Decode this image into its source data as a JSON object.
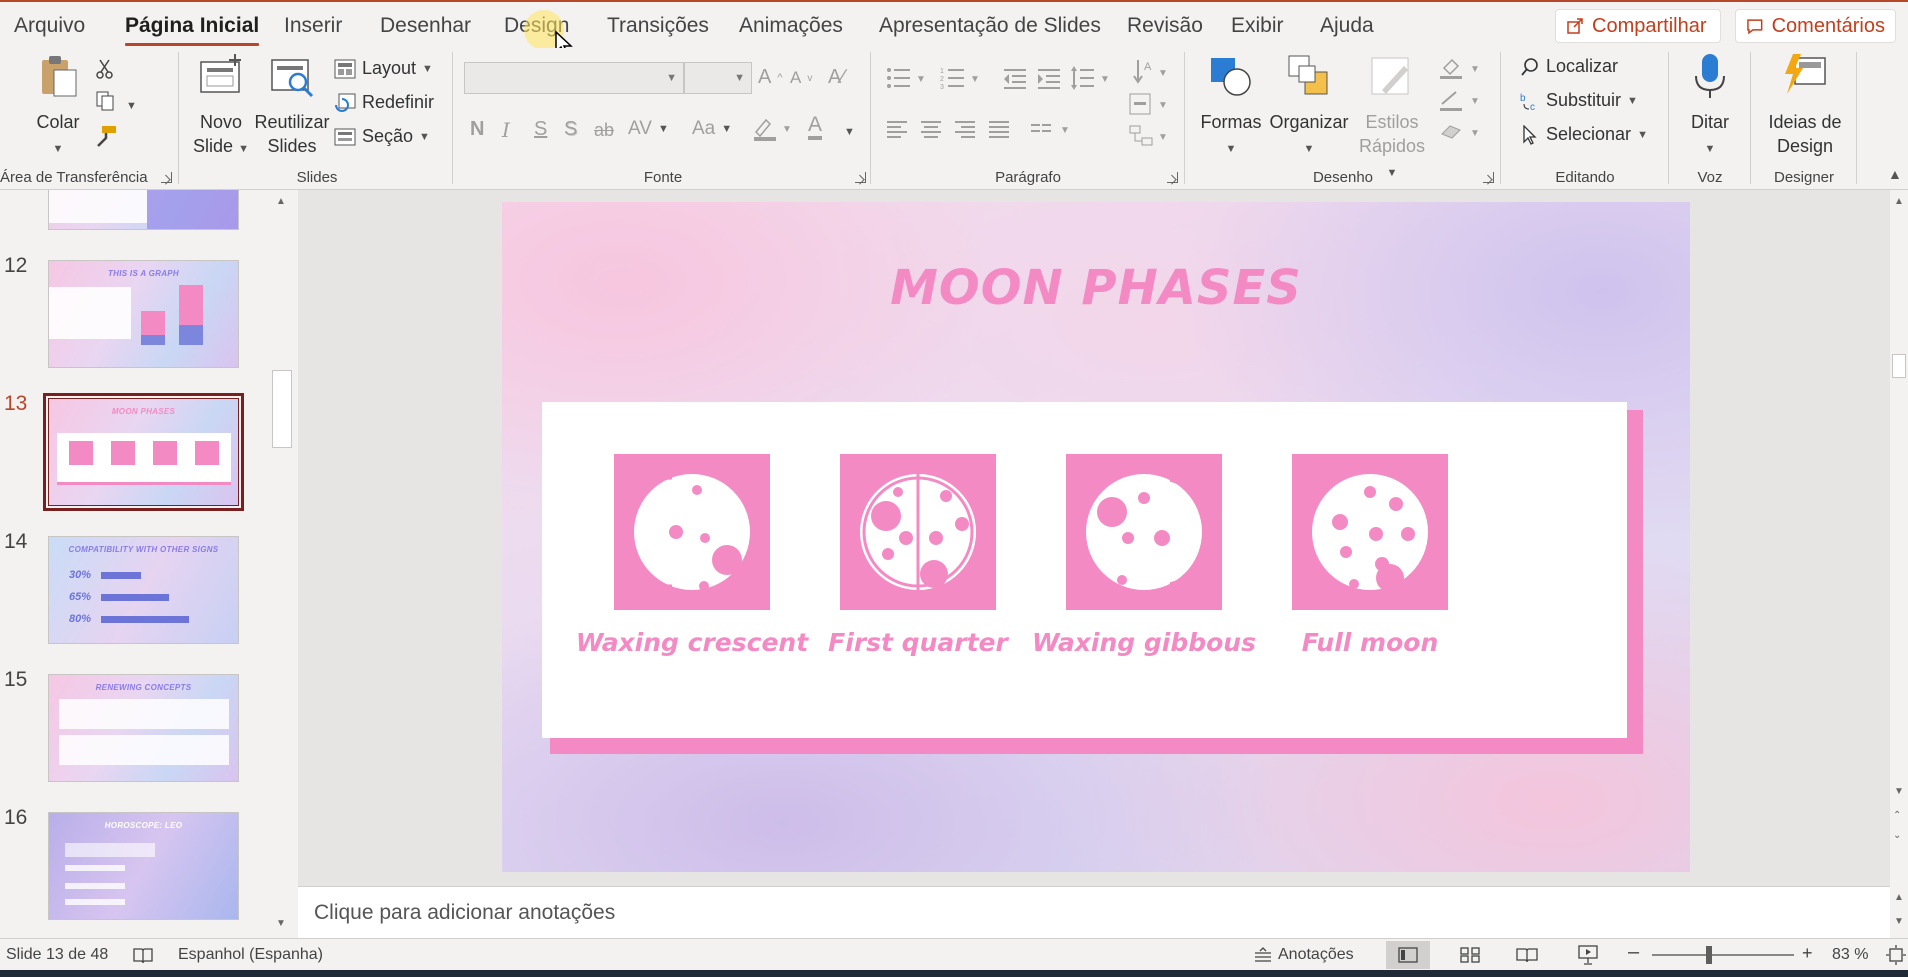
{
  "tabs": [
    "Arquivo",
    "Página Inicial",
    "Inserir",
    "Desenhar",
    "Design",
    "Transições",
    "Animações",
    "Apresentação de Slides",
    "Revisão",
    "Exibir",
    "Ajuda"
  ],
  "share_label": "Compartilhar",
  "comments_label": "Comentários",
  "ribbon": {
    "clipboard": {
      "paste": "Colar",
      "group": "Área de Transferência"
    },
    "slides": {
      "new_slide_1": "Novo",
      "new_slide_2": "Slide",
      "reuse_1": "Reutilizar",
      "reuse_2": "Slides",
      "layout": "Layout",
      "reset": "Redefinir",
      "section": "Seção",
      "group": "Slides"
    },
    "font": {
      "bold": "N",
      "italic": "I",
      "underline": "S",
      "shadow": "S",
      "strike": "ab",
      "spacing": "AV",
      "case": "Aa",
      "color": "A",
      "group": "Fonte"
    },
    "paragraph": {
      "group": "Parágrafo"
    },
    "drawing": {
      "shapes": "Formas",
      "arrange": "Organizar",
      "styles_1": "Estilos",
      "styles_2": "Rápidos",
      "group": "Desenho"
    },
    "editing": {
      "find": "Localizar",
      "replace": "Substituir",
      "select": "Selecionar",
      "group": "Editando"
    },
    "voice": {
      "dictate": "Ditar",
      "group": "Voz"
    },
    "designer": {
      "ideas_1": "Ideias de",
      "ideas_2": "Design",
      "group": "Designer"
    }
  },
  "thumbnails": [
    {
      "number": "12",
      "title": "THIS IS A GRAPH"
    },
    {
      "number": "13",
      "title": "MOON PHASES",
      "current": true
    },
    {
      "number": "14",
      "title": "COMPATIBILITY WITH OTHER SIGNS",
      "bars": [
        "30%",
        "65%",
        "80%"
      ]
    },
    {
      "number": "15",
      "title": "RENEWING CONCEPTS"
    },
    {
      "number": "16",
      "title": "HOROSCOPE: LEO"
    }
  ],
  "slide": {
    "title": "MOON PHASES",
    "phases": [
      "Waxing crescent",
      "First quarter",
      "Waxing gibbous",
      "Full moon"
    ],
    "colors": {
      "accent": "#f48ac4"
    }
  },
  "notes_placeholder": "Clique para adicionar anotações",
  "status": {
    "slide_counter": "Slide 13 de 48",
    "language": "Espanhol (Espanha)",
    "notes": "Anotações",
    "zoom": "83 %"
  }
}
